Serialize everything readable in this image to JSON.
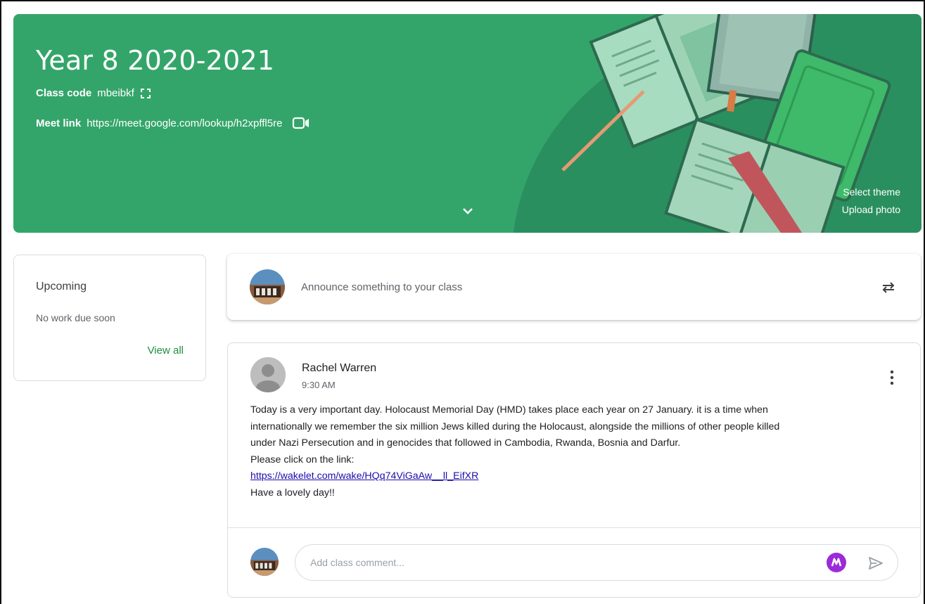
{
  "header": {
    "class_title": "Year 8 2020-2021",
    "class_code_label": "Class code",
    "class_code": "mbeibkf",
    "meet_label": "Meet link",
    "meet_url": "https://meet.google.com/lookup/h2xpffl5re",
    "select_theme": "Select theme",
    "upload_photo": "Upload photo",
    "banner_color": "#34a56a"
  },
  "upcoming": {
    "title": "Upcoming",
    "empty_text": "No work due soon",
    "view_all": "View all"
  },
  "announce": {
    "placeholder": "Announce something to your class"
  },
  "post": {
    "author": "Rachel Warren",
    "time": "9:30 AM",
    "lines": [
      "Today is a very important day. Holocaust Memorial Day (HMD) takes place each year on 27 January. it is a time when",
      "internationally we remember the six million Jews killed during the Holocaust, alongside the millions of other people killed",
      "under Nazi Persecution and in genocides that followed in Cambodia, Rwanda, Bosnia and Darfur.",
      "Please click on the link:"
    ],
    "link": "https://wakelet.com/wake/HQq74ViGaAw__ll_EifXR",
    "closing": "Have a lovely day!!",
    "comment_placeholder": "Add class comment..."
  },
  "icons": {
    "fullscreen": "fullscreen-icon",
    "video": "video-camera-icon",
    "chevron": "chevron-down-icon",
    "reuse": "reuse-post-icon",
    "more": "more-vert-icon",
    "send": "send-icon",
    "extension": "extension-icon"
  },
  "colors": {
    "accent_green": "#1e8e3e",
    "link_blue": "#1a0dab",
    "extension_purple": "#9b2bd8"
  }
}
